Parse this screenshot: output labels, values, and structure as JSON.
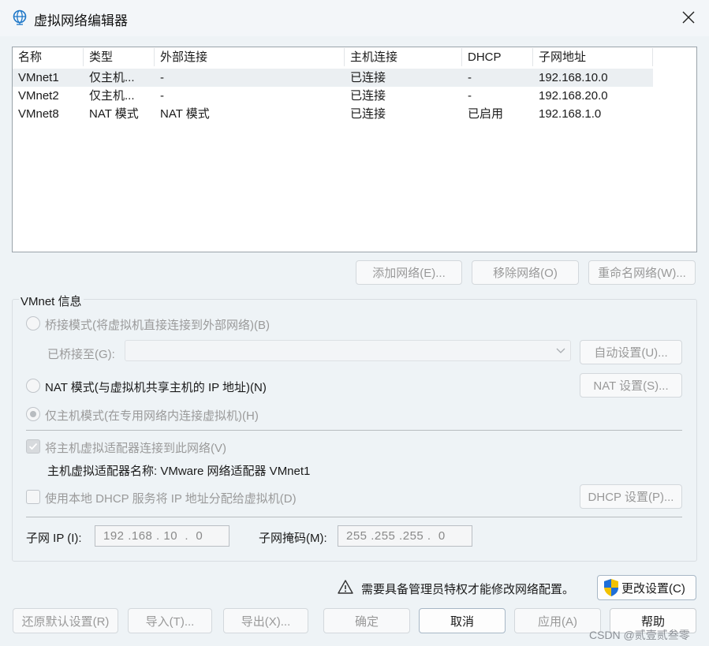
{
  "window": {
    "title": "虚拟网络编辑器",
    "icon": "globe-network-icon",
    "close_icon": "close-icon"
  },
  "table": {
    "columns": [
      "名称",
      "类型",
      "外部连接",
      "主机连接",
      "DHCP",
      "子网地址"
    ],
    "rows": [
      [
        "VMnet1",
        "仅主机...",
        "-",
        "已连接",
        "-",
        "192.168.10.0"
      ],
      [
        "VMnet2",
        "仅主机...",
        "-",
        "已连接",
        "-",
        "192.168.20.0"
      ],
      [
        "VMnet8",
        "NAT 模式",
        "NAT 模式",
        "已连接",
        "已启用",
        "192.168.1.0"
      ]
    ],
    "selected_row": 0
  },
  "network_buttons": {
    "add": "添加网络(E)...",
    "remove": "移除网络(O)",
    "rename": "重命名网络(W)..."
  },
  "vmnet_info": {
    "legend": "VMnet 信息",
    "bridged_radio": "桥接模式(将虚拟机直接连接到外部网络)(B)",
    "bridged_to_label": "已桥接至(G):",
    "auto_settings_button": "自动设置(U)...",
    "nat_radio": "NAT 模式(与虚拟机共享主机的 IP 地址)(N)",
    "nat_settings_button": "NAT 设置(S)...",
    "hostonly_radio": "仅主机模式(在专用网络内连接虚拟机)(H)",
    "selected_mode": "host-only",
    "connect_adapter_checkbox": "将主机虚拟适配器连接到此网络(V)",
    "connect_adapter_checked": true,
    "adapter_name_text": "主机虚拟适配器名称: VMware 网络适配器 VMnet1",
    "dhcp_checkbox": "使用本地 DHCP 服务将 IP 地址分配给虚拟机(D)",
    "dhcp_checked": false,
    "dhcp_settings_button": "DHCP 设置(P)...",
    "subnet_ip_label": "子网 IP (I):",
    "subnet_ip_value": "192 .168 . 10  .  0",
    "subnet_mask_label": "子网掩码(M):",
    "subnet_mask_value": "255 .255 .255 .  0"
  },
  "admin": {
    "warning_icon": "warning-triangle-icon",
    "message": "需要具备管理员特权才能修改网络配置。",
    "shield_icon": "uac-shield-icon",
    "change_settings_button": "更改设置(C)"
  },
  "footer_buttons": {
    "restore_defaults": "还原默认设置(R)",
    "import": "导入(T)...",
    "export": "导出(X)...",
    "ok": "确定",
    "cancel": "取消",
    "apply": "应用(A)",
    "help": "帮助"
  },
  "watermark": "CSDN @贰壹贰叁零",
  "colors": {
    "background": "#eef3f6",
    "selected_row": "#ebeff2",
    "disabled_text": "#9a9a9a",
    "shield_blue": "#1e6fd9",
    "shield_yellow": "#f2c200"
  }
}
